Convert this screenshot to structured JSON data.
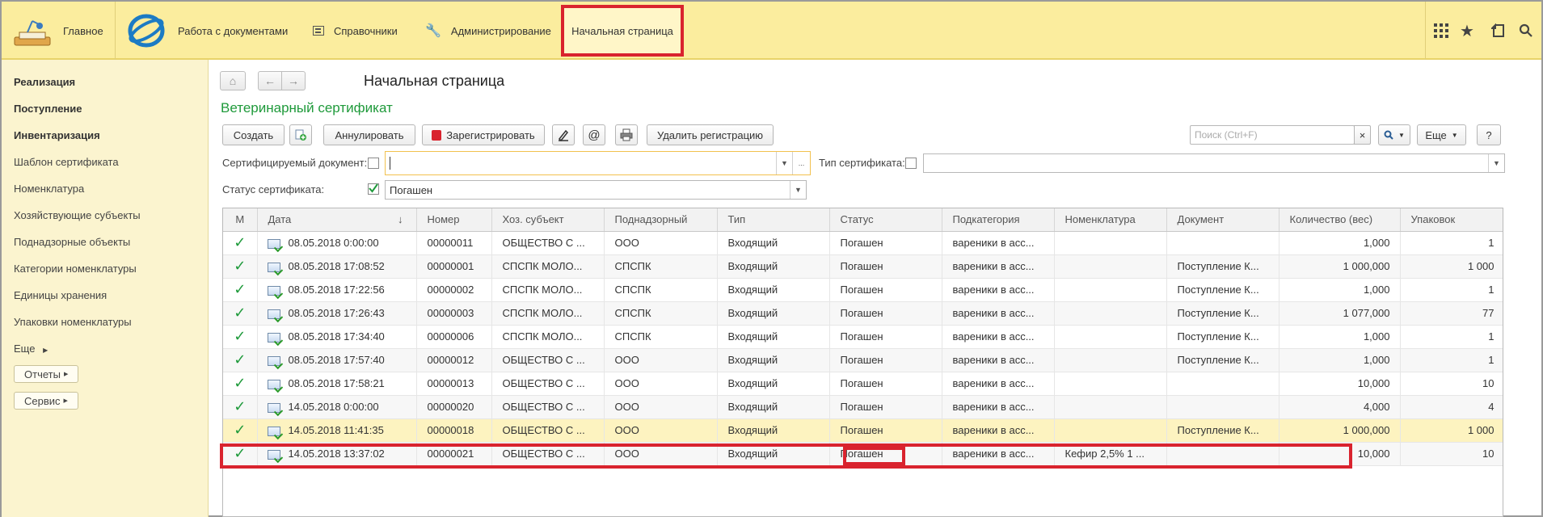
{
  "topbar": {
    "home_label": "Главное",
    "sections": [
      "Работа с документами",
      "Справочники",
      "Администрирование"
    ],
    "active_tab": "Начальная страница",
    "icons": [
      "apps-grid-icon",
      "star-icon",
      "history-icon",
      "search-icon"
    ]
  },
  "sidebar": {
    "items": [
      {
        "label": "Реализация",
        "bold": true
      },
      {
        "label": "Поступление",
        "bold": true
      },
      {
        "label": "Инвентаризация",
        "bold": true
      },
      {
        "label": "Шаблон сертификата",
        "bold": false
      },
      {
        "label": "Номенклатура",
        "bold": false
      },
      {
        "label": "Хозяйствующие субъекты",
        "bold": false
      },
      {
        "label": "Поднадзорные объекты",
        "bold": false
      },
      {
        "label": "Категории номенклатуры",
        "bold": false
      },
      {
        "label": "Единицы хранения",
        "bold": false
      },
      {
        "label": "Упаковки номенклатуры",
        "bold": false
      },
      {
        "label": "Еще",
        "bold": false
      }
    ],
    "buttons": [
      "Отчеты",
      "Сервис"
    ]
  },
  "main": {
    "page_title": "Начальная страница",
    "form_title": "Ветеринарный сертификат",
    "toolbar": {
      "create": "Создать",
      "annul": "Аннулировать",
      "register": "Зарегистрировать",
      "email_symbol": "@",
      "delete_registration": "Удалить регистрацию",
      "search_placeholder": "Поиск (Ctrl+F)",
      "clear_symbol": "×",
      "more": "Еще",
      "help": "?"
    },
    "filters": {
      "doc_label": "Сертифицируемый документ:",
      "doc_value": "",
      "doc_extra": "...",
      "cert_type_label": "Тип сертификата:",
      "status_label": "Статус сертификата:",
      "status_value": "Погашен"
    },
    "table": {
      "columns": [
        "М",
        "Дата",
        "Номер",
        "Хоз. субъект",
        "Поднадзорный",
        "Тип",
        "Статус",
        "Подкатегория",
        "Номенклатура",
        "Документ",
        "Количество (вес)",
        "Упаковок"
      ],
      "rows": [
        {
          "date": "08.05.2018 0:00:00",
          "num": "00000011",
          "subj": "ОБЩЕСТВО С ...",
          "sup": "ООО",
          "type": "Входящий",
          "status": "Погашен",
          "subcat": "вареники в асс...",
          "nom": "",
          "doc": "",
          "qty": "1,000",
          "pack": "1"
        },
        {
          "date": "08.05.2018 17:08:52",
          "num": "00000001",
          "subj": "СПСПК МОЛО...",
          "sup": "СПСПК",
          "type": "Входящий",
          "status": "Погашен",
          "subcat": "вареники в асс...",
          "nom": "",
          "doc": "Поступление К...",
          "qty": "1 000,000",
          "pack": "1 000"
        },
        {
          "date": "08.05.2018 17:22:56",
          "num": "00000002",
          "subj": "СПСПК МОЛО...",
          "sup": "СПСПК",
          "type": "Входящий",
          "status": "Погашен",
          "subcat": "вареники в асс...",
          "nom": "",
          "doc": "Поступление К...",
          "qty": "1,000",
          "pack": "1"
        },
        {
          "date": "08.05.2018 17:26:43",
          "num": "00000003",
          "subj": "СПСПК МОЛО...",
          "sup": "СПСПК",
          "type": "Входящий",
          "status": "Погашен",
          "subcat": "вареники в асс...",
          "nom": "",
          "doc": "Поступление К...",
          "qty": "1 077,000",
          "pack": "77"
        },
        {
          "date": "08.05.2018 17:34:40",
          "num": "00000006",
          "subj": "СПСПК МОЛО...",
          "sup": "СПСПК",
          "type": "Входящий",
          "status": "Погашен",
          "subcat": "вареники в асс...",
          "nom": "",
          "doc": "Поступление К...",
          "qty": "1,000",
          "pack": "1"
        },
        {
          "date": "08.05.2018 17:57:40",
          "num": "00000012",
          "subj": "ОБЩЕСТВО С ...",
          "sup": "ООО",
          "type": "Входящий",
          "status": "Погашен",
          "subcat": "вареники в асс...",
          "nom": "",
          "doc": "Поступление К...",
          "qty": "1,000",
          "pack": "1"
        },
        {
          "date": "08.05.2018 17:58:21",
          "num": "00000013",
          "subj": "ОБЩЕСТВО С ...",
          "sup": "ООО",
          "type": "Входящий",
          "status": "Погашен",
          "subcat": "вареники в асс...",
          "nom": "",
          "doc": "",
          "qty": "10,000",
          "pack": "10"
        },
        {
          "date": "14.05.2018 0:00:00",
          "num": "00000020",
          "subj": "ОБЩЕСТВО С ...",
          "sup": "ООО",
          "type": "Входящий",
          "status": "Погашен",
          "subcat": "вареники в асс...",
          "nom": "",
          "doc": "",
          "qty": "4,000",
          "pack": "4"
        },
        {
          "date": "14.05.2018 11:41:35",
          "num": "00000018",
          "subj": "ОБЩЕСТВО С ...",
          "sup": "ООО",
          "type": "Входящий",
          "status": "Погашен",
          "subcat": "вареники в асс...",
          "nom": "",
          "doc": "Поступление К...",
          "qty": "1 000,000",
          "pack": "1 000"
        },
        {
          "date": "14.05.2018 13:37:02",
          "num": "00000021",
          "subj": "ОБЩЕСТВО С ...",
          "sup": "ООО",
          "type": "Входящий",
          "status": "Погашен",
          "subcat": "вареники в асс...",
          "nom": "Кефир 2,5%  1 ...",
          "doc": "",
          "qty": "10,000",
          "pack": "10"
        }
      ]
    }
  },
  "colors": {
    "topbar_bg": "#fbed9e",
    "sidebar_bg": "#fbf4cf",
    "form_title": "#1f9a3b",
    "highlight_red": "#d9232e",
    "selected_row": "#fdf3c0"
  }
}
